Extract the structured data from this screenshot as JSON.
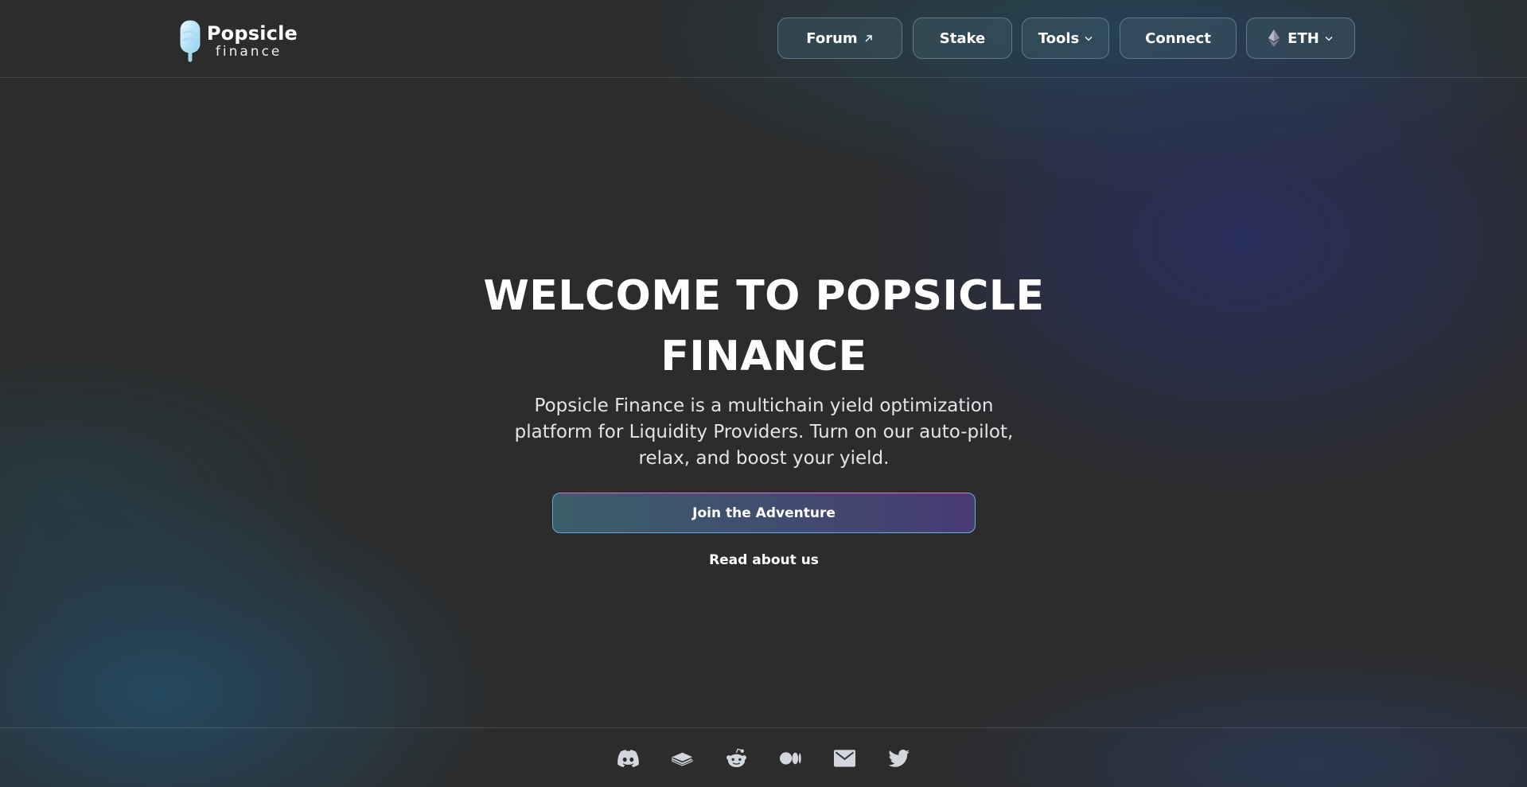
{
  "brand": {
    "name": "Popsicle",
    "sub": "finance"
  },
  "nav": {
    "forum": "Forum",
    "stake": "Stake",
    "tools": "Tools",
    "connect": "Connect",
    "network": "ETH"
  },
  "hero": {
    "title_line1": "WELCOME TO POPSICLE",
    "title_line2": "FINANCE",
    "desc_line1": "Popsicle Finance is a multichain yield optimization",
    "desc_line2": "platform for Liquidity Providers. Turn on our auto-pilot,",
    "desc_line3": "relax, and boost your yield.",
    "cta": "Join the Adventure",
    "read_more": "Read about us"
  },
  "footer": {
    "icons": [
      "discord-icon",
      "docs-book-icon",
      "reddit-icon",
      "medium-icon",
      "email-icon",
      "twitter-icon"
    ]
  },
  "colors": {
    "background": "#2c2c2c",
    "button_border": "#96b9c3",
    "cta_border": "#5fb5c8",
    "cta_gradient_start": "#3b5e68",
    "cta_gradient_end": "#473a72"
  }
}
